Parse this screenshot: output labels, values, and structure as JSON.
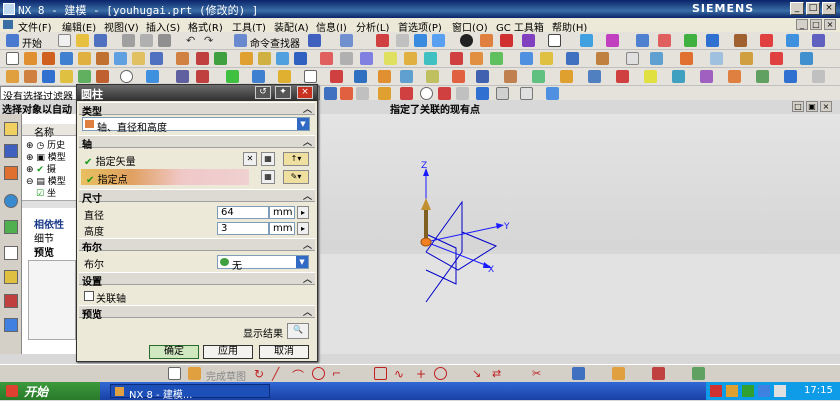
{
  "window": {
    "title": "NX 8 - 建模 - [youhugai.prt  (修改的) ]",
    "brand": "SIEMENS"
  },
  "menubar": {
    "items": [
      "文件(F)",
      "编辑(E)",
      "视图(V)",
      "插入(S)",
      "格式(R)",
      "工具(T)",
      "装配(A)",
      "信息(I)",
      "分析(L)",
      "首选项(P)",
      "窗口(O)",
      "GC 工具箱",
      "帮助(H)"
    ]
  },
  "toolbar": {
    "start_label": "开始",
    "command_finder": "命令查找器"
  },
  "selection": {
    "filter_text": "没有选择过滤器",
    "cue_left": "选择对象以自动",
    "cue_center": "指定了关联的现有点"
  },
  "navigator": {
    "column_header": "名称",
    "items": [
      "历史",
      "模型",
      "摄",
      "模型",
      "坐"
    ],
    "tabs": [
      "相依性",
      "细节",
      "预览"
    ]
  },
  "dialog": {
    "title": "圆柱",
    "sections": {
      "type": "类型",
      "axis": "轴",
      "dimensions": "尺寸",
      "boolean": "布尔",
      "settings": "设置",
      "preview": "预览"
    },
    "type_value": "轴、直径和高度",
    "specify_vector": "指定矢量",
    "specify_point": "指定点",
    "diameter_label": "直径",
    "diameter_value": "64",
    "height_label": "高度",
    "height_value": "3",
    "unit": "mm",
    "boolean_label": "布尔",
    "boolean_value": "无",
    "associative_axis": "关联轴",
    "show_result": "显示结果",
    "buttons": {
      "ok": "确定",
      "apply": "应用",
      "cancel": "取消"
    }
  },
  "viewport": {
    "axis_labels": {
      "z": "Z",
      "y": "Y",
      "x": "X"
    }
  },
  "bottombar": {
    "sketch_label": "完成草图"
  },
  "taskbar": {
    "start": "开始",
    "task": "NX 8 - 建模...",
    "time": "17:15"
  },
  "colors": {
    "title_bar": "#0a246a",
    "ok_green": "#1a9a1a",
    "accent_blue": "#316ac5",
    "axis_blue": "#1a1aff",
    "point_orange": "#f08020"
  }
}
